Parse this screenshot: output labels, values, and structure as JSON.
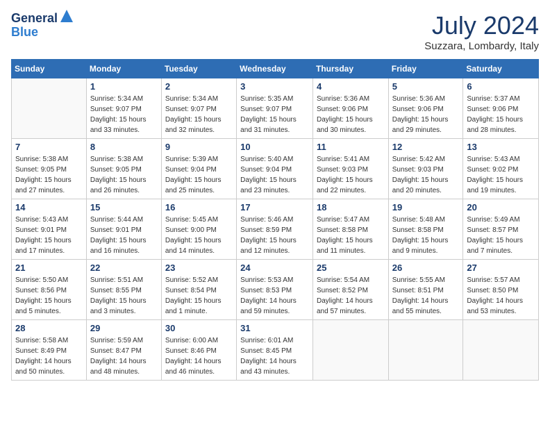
{
  "header": {
    "logo_line1": "General",
    "logo_line2": "Blue",
    "month": "July 2024",
    "location": "Suzzara, Lombardy, Italy"
  },
  "weekdays": [
    "Sunday",
    "Monday",
    "Tuesday",
    "Wednesday",
    "Thursday",
    "Friday",
    "Saturday"
  ],
  "weeks": [
    [
      {
        "day": "",
        "info": ""
      },
      {
        "day": "1",
        "info": "Sunrise: 5:34 AM\nSunset: 9:07 PM\nDaylight: 15 hours\nand 33 minutes."
      },
      {
        "day": "2",
        "info": "Sunrise: 5:34 AM\nSunset: 9:07 PM\nDaylight: 15 hours\nand 32 minutes."
      },
      {
        "day": "3",
        "info": "Sunrise: 5:35 AM\nSunset: 9:07 PM\nDaylight: 15 hours\nand 31 minutes."
      },
      {
        "day": "4",
        "info": "Sunrise: 5:36 AM\nSunset: 9:06 PM\nDaylight: 15 hours\nand 30 minutes."
      },
      {
        "day": "5",
        "info": "Sunrise: 5:36 AM\nSunset: 9:06 PM\nDaylight: 15 hours\nand 29 minutes."
      },
      {
        "day": "6",
        "info": "Sunrise: 5:37 AM\nSunset: 9:06 PM\nDaylight: 15 hours\nand 28 minutes."
      }
    ],
    [
      {
        "day": "7",
        "info": "Sunrise: 5:38 AM\nSunset: 9:05 PM\nDaylight: 15 hours\nand 27 minutes."
      },
      {
        "day": "8",
        "info": "Sunrise: 5:38 AM\nSunset: 9:05 PM\nDaylight: 15 hours\nand 26 minutes."
      },
      {
        "day": "9",
        "info": "Sunrise: 5:39 AM\nSunset: 9:04 PM\nDaylight: 15 hours\nand 25 minutes."
      },
      {
        "day": "10",
        "info": "Sunrise: 5:40 AM\nSunset: 9:04 PM\nDaylight: 15 hours\nand 23 minutes."
      },
      {
        "day": "11",
        "info": "Sunrise: 5:41 AM\nSunset: 9:03 PM\nDaylight: 15 hours\nand 22 minutes."
      },
      {
        "day": "12",
        "info": "Sunrise: 5:42 AM\nSunset: 9:03 PM\nDaylight: 15 hours\nand 20 minutes."
      },
      {
        "day": "13",
        "info": "Sunrise: 5:43 AM\nSunset: 9:02 PM\nDaylight: 15 hours\nand 19 minutes."
      }
    ],
    [
      {
        "day": "14",
        "info": "Sunrise: 5:43 AM\nSunset: 9:01 PM\nDaylight: 15 hours\nand 17 minutes."
      },
      {
        "day": "15",
        "info": "Sunrise: 5:44 AM\nSunset: 9:01 PM\nDaylight: 15 hours\nand 16 minutes."
      },
      {
        "day": "16",
        "info": "Sunrise: 5:45 AM\nSunset: 9:00 PM\nDaylight: 15 hours\nand 14 minutes."
      },
      {
        "day": "17",
        "info": "Sunrise: 5:46 AM\nSunset: 8:59 PM\nDaylight: 15 hours\nand 12 minutes."
      },
      {
        "day": "18",
        "info": "Sunrise: 5:47 AM\nSunset: 8:58 PM\nDaylight: 15 hours\nand 11 minutes."
      },
      {
        "day": "19",
        "info": "Sunrise: 5:48 AM\nSunset: 8:58 PM\nDaylight: 15 hours\nand 9 minutes."
      },
      {
        "day": "20",
        "info": "Sunrise: 5:49 AM\nSunset: 8:57 PM\nDaylight: 15 hours\nand 7 minutes."
      }
    ],
    [
      {
        "day": "21",
        "info": "Sunrise: 5:50 AM\nSunset: 8:56 PM\nDaylight: 15 hours\nand 5 minutes."
      },
      {
        "day": "22",
        "info": "Sunrise: 5:51 AM\nSunset: 8:55 PM\nDaylight: 15 hours\nand 3 minutes."
      },
      {
        "day": "23",
        "info": "Sunrise: 5:52 AM\nSunset: 8:54 PM\nDaylight: 15 hours\nand 1 minute."
      },
      {
        "day": "24",
        "info": "Sunrise: 5:53 AM\nSunset: 8:53 PM\nDaylight: 14 hours\nand 59 minutes."
      },
      {
        "day": "25",
        "info": "Sunrise: 5:54 AM\nSunset: 8:52 PM\nDaylight: 14 hours\nand 57 minutes."
      },
      {
        "day": "26",
        "info": "Sunrise: 5:55 AM\nSunset: 8:51 PM\nDaylight: 14 hours\nand 55 minutes."
      },
      {
        "day": "27",
        "info": "Sunrise: 5:57 AM\nSunset: 8:50 PM\nDaylight: 14 hours\nand 53 minutes."
      }
    ],
    [
      {
        "day": "28",
        "info": "Sunrise: 5:58 AM\nSunset: 8:49 PM\nDaylight: 14 hours\nand 50 minutes."
      },
      {
        "day": "29",
        "info": "Sunrise: 5:59 AM\nSunset: 8:47 PM\nDaylight: 14 hours\nand 48 minutes."
      },
      {
        "day": "30",
        "info": "Sunrise: 6:00 AM\nSunset: 8:46 PM\nDaylight: 14 hours\nand 46 minutes."
      },
      {
        "day": "31",
        "info": "Sunrise: 6:01 AM\nSunset: 8:45 PM\nDaylight: 14 hours\nand 43 minutes."
      },
      {
        "day": "",
        "info": ""
      },
      {
        "day": "",
        "info": ""
      },
      {
        "day": "",
        "info": ""
      }
    ]
  ]
}
